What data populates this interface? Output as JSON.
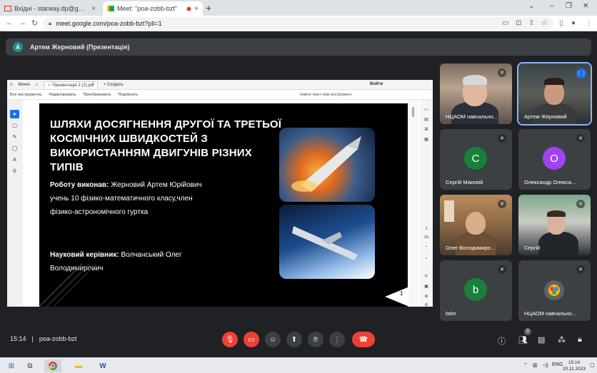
{
  "browser": {
    "tabs": [
      {
        "label": "Вхідні - starway.dp@gmail.com",
        "close": "×"
      },
      {
        "label": "Meet: \"poa-zobb-bzt\"",
        "close": "×"
      }
    ],
    "new_tab": "+",
    "window_controls": {
      "minimize": "–",
      "maximize": "❐",
      "close": "✕"
    },
    "url": "meet.google.com/poa-zobb-bzt?pli=1"
  },
  "meet": {
    "presenter_label": "Артем Жерновий (Презентація)",
    "presenter_initial": "А",
    "time": "15:14",
    "meeting_code": "poa-zobb-bzt",
    "people_badge": "9"
  },
  "acrobat": {
    "menu_label": "Меню",
    "tab_title": "Презентація 2 (2).pdf",
    "create_label": "+ Создать",
    "sign_in": "Войти",
    "menu_items": [
      "Все инструменты",
      "Редактировать",
      "Преобразовать",
      "Подписать"
    ],
    "search_label": "Найти текст или инструмент",
    "page_current": "1",
    "page_total": "15"
  },
  "slide": {
    "title": "ШЛЯХИ ДОСЯГНЕННЯ  ДРУГОЇ ТА ТРЕТЬОЇ КОСМІЧНИХ ШВИДКОСТЕЙ З ВИКОРИСТАННЯМ ДВИГУНІВ РІЗНИХ ТИПІВ",
    "author_label": "Роботу виконав:",
    "author_text": " Жерновий Артем Юрійович учень 10 фізико-математичного класу,член фізико-астрономічного гуртка",
    "supervisor_label": "Науковий керівник:",
    "supervisor_text": " Волчанський Олег Володимирович",
    "page_number": "1"
  },
  "participants": [
    {
      "name": "НЦАОМ навчально...",
      "type": "video",
      "mic": "off"
    },
    {
      "name": "Артем Жерновий",
      "type": "video",
      "mic": "on"
    },
    {
      "name": "Сергій Маковій",
      "type": "avatar",
      "initial": "С",
      "color": "#188038",
      "mic": "off"
    },
    {
      "name": "Олександр Олекса...",
      "type": "avatar",
      "initial": "О",
      "color": "#a142f4",
      "mic": "off"
    },
    {
      "name": "Олег Володимиро...",
      "type": "video",
      "mic": "off"
    },
    {
      "name": "Сергій",
      "type": "video",
      "mic": "off"
    },
    {
      "name": "bdm",
      "type": "avatar",
      "initial": "b",
      "color": "#188038",
      "mic": "off"
    },
    {
      "name": "НЦАОМ навчально...",
      "type": "avatar",
      "initial": "",
      "color": "#5f6368",
      "mic": "off"
    }
  ],
  "taskbar": {
    "language": "ENG",
    "time": "15:14",
    "date": "20.11.2023"
  }
}
